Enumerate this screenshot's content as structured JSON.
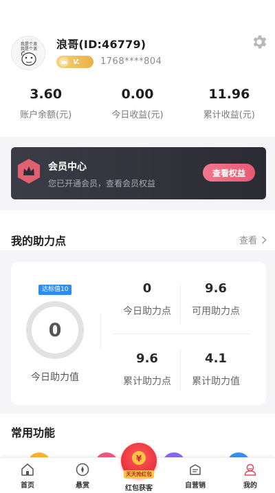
{
  "profile": {
    "username": "浪哥(ID:46779)",
    "vip_level": "V.",
    "phone": "1768****804",
    "avatar_text": "我是个浪 我是个浪"
  },
  "stats": [
    {
      "value": "3.60",
      "label": "账户余额(元)"
    },
    {
      "value": "0.00",
      "label": "今日收益(元)"
    },
    {
      "value": "11.96",
      "label": "累计收益(元)"
    }
  ],
  "member": {
    "title": "会员中心",
    "subtitle": "您已开通会员，查看会员权益",
    "button": "查看权益"
  },
  "help_points": {
    "title": "我的助力点",
    "link": "查看",
    "target_tag": "达标值10",
    "today_value": "0",
    "today_label": "今日助力值",
    "ring_progress": 0,
    "cells": [
      {
        "value": "0",
        "label": "今日助力点"
      },
      {
        "value": "9.6",
        "label": "可用助力点"
      },
      {
        "value": "9.6",
        "label": "累计助力点"
      },
      {
        "value": "4.1",
        "label": "累计助力值"
      }
    ]
  },
  "functions": {
    "title": "常用功能",
    "peek_colors": [
      "#f5b731",
      "#ef5a7a",
      "#8a6ae8",
      "#3c8ef2"
    ]
  },
  "tabbar": {
    "items": [
      {
        "label": "首页",
        "icon": "home-icon"
      },
      {
        "label": "悬赏",
        "icon": "bounty-icon"
      },
      {
        "label": "红包获客",
        "icon": "red-packet-icon",
        "ribbon": "天天抢红包"
      },
      {
        "label": "自营销",
        "icon": "marketing-icon"
      },
      {
        "label": "我的",
        "icon": "profile-icon"
      }
    ],
    "active_index": 4,
    "active_color": "#e8485e"
  },
  "colors": {
    "accent": "#e65a72",
    "vip_gold": "#e9b048",
    "tag_blue": "#2f8cf0",
    "card_dark": "#2b2b33"
  }
}
